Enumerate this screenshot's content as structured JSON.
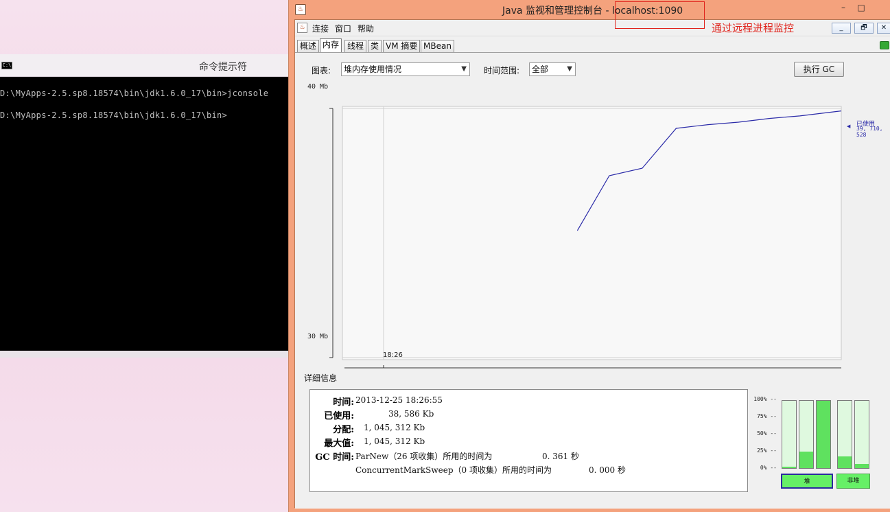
{
  "cmd": {
    "title": "命令提示符",
    "icon_text": "C:\\",
    "lines": [
      "D:\\MyApps-2.5.sp8.18574\\bin\\jdk1.6.0_17\\bin>jconsole",
      "D:\\MyApps-2.5.sp8.18574\\bin\\jdk1.6.0_17\\bin>"
    ]
  },
  "window": {
    "title": "Java 监视和管理控制台 - localhost:1090",
    "icon": "java-cup-icon",
    "annotation": "通过远程进程监控",
    "annotation_color": "#e0231c"
  },
  "menu": {
    "items": [
      "连接",
      "窗口",
      "帮助"
    ]
  },
  "tabs": [
    "概述",
    "内存",
    "线程",
    "类",
    "VM 摘要",
    "MBean"
  ],
  "active_tab": "内存",
  "controls": {
    "chart_label": "图表:",
    "chart_select": "堆内存使用情况",
    "range_label": "时间范围:",
    "range_select": "全部",
    "gc_button": "执行 GC"
  },
  "chart_data": {
    "type": "line",
    "y_unit_labels": [
      "40 Mb",
      "30 Mb"
    ],
    "ylim": [
      30,
      40
    ],
    "x_tick_labels": [
      "18:26"
    ],
    "series": [
      {
        "name": "已使用",
        "color": "#2a2aa8",
        "points": [
          [
            0.471,
            35.1
          ],
          [
            0.535,
            37.3
          ],
          [
            0.601,
            37.6
          ],
          [
            0.669,
            39.2
          ],
          [
            0.733,
            39.35
          ],
          [
            0.794,
            39.45
          ],
          [
            0.857,
            39.6
          ],
          [
            0.917,
            39.7
          ],
          [
            1.0,
            39.9
          ]
        ]
      }
    ],
    "latest_value_label": "39, 710, 528"
  },
  "details": {
    "title": "详细信息",
    "time_label": "时间:",
    "time_value": "2013-12-25 18:26:55",
    "used_label": "已使用:",
    "used_value": "38, 586  Kb",
    "committed_label": "分配:",
    "committed_value": "1, 045, 312  Kb",
    "max_label": "最大值:",
    "max_value": "1, 045, 312  Kb",
    "gc_label": "GC 时间:",
    "gc_rows": [
      {
        "text": "ParNew（26 项收集）所用的时间为",
        "value": "0. 361  秒"
      },
      {
        "text": "ConcurrentMarkSweep（0 项收集）所用的时间为",
        "value": "0. 000  秒"
      }
    ]
  },
  "memory_bars": {
    "percent_labels": [
      "100% --",
      "75% --",
      "50% --",
      "25% --",
      "0% --"
    ],
    "heap": [
      0.02,
      0.25,
      1.0
    ],
    "non_heap": [
      0.17,
      0.06
    ],
    "heap_button": "堆",
    "non_heap_button": "非堆",
    "fill_color": "#5fe15f"
  }
}
